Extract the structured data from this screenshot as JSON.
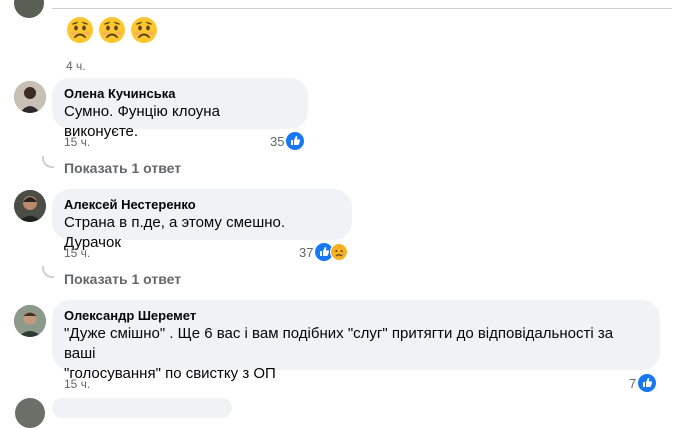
{
  "top_comment": {
    "time": "4 ч.",
    "emojis": [
      "worried-face-icon",
      "worried-face-icon",
      "worried-face-icon"
    ]
  },
  "comments": [
    {
      "author": "Олена Кучинська",
      "text": "Сумно. Фунцію клоуна виконуєте.",
      "time": "15 ч.",
      "reaction_count": "35",
      "reply_label": "Показать 1 ответ"
    },
    {
      "author": "Алексей Нестеренко",
      "text": "Страна в п.де, а этому смешно. Дурачок",
      "time": "15 ч.",
      "reaction_count": "37",
      "reply_label": "Показать 1 ответ"
    },
    {
      "author": "Олександр Шеремет",
      "text_line1": "\"Дуже смішно\" . Ще 6 вас і вам подібних \"слуг\" притягти до відповідальності за ваші",
      "text_line2": "\"голосування\" по свистку з ОП",
      "time": "15 ч.",
      "reaction_count": "7"
    }
  ],
  "colors": {
    "like_blue": "#1877f2",
    "bubble": "#f0f2f5",
    "muted": "#65676b",
    "sad_yellow": "#f7b125"
  }
}
